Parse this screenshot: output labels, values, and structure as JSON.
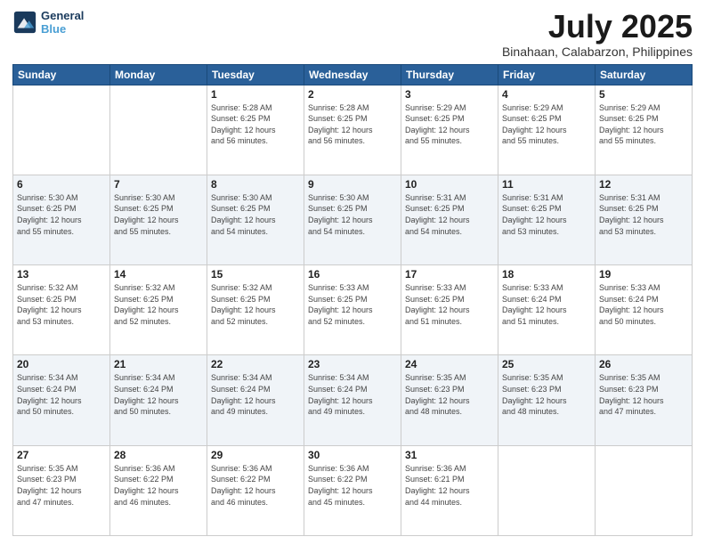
{
  "logo": {
    "line1": "General",
    "line2": "Blue"
  },
  "title": "July 2025",
  "subtitle": "Binahaan, Calabarzon, Philippines",
  "days_of_week": [
    "Sunday",
    "Monday",
    "Tuesday",
    "Wednesday",
    "Thursday",
    "Friday",
    "Saturday"
  ],
  "weeks": [
    [
      {
        "day": "",
        "info": ""
      },
      {
        "day": "",
        "info": ""
      },
      {
        "day": "1",
        "info": "Sunrise: 5:28 AM\nSunset: 6:25 PM\nDaylight: 12 hours\nand 56 minutes."
      },
      {
        "day": "2",
        "info": "Sunrise: 5:28 AM\nSunset: 6:25 PM\nDaylight: 12 hours\nand 56 minutes."
      },
      {
        "day": "3",
        "info": "Sunrise: 5:29 AM\nSunset: 6:25 PM\nDaylight: 12 hours\nand 55 minutes."
      },
      {
        "day": "4",
        "info": "Sunrise: 5:29 AM\nSunset: 6:25 PM\nDaylight: 12 hours\nand 55 minutes."
      },
      {
        "day": "5",
        "info": "Sunrise: 5:29 AM\nSunset: 6:25 PM\nDaylight: 12 hours\nand 55 minutes."
      }
    ],
    [
      {
        "day": "6",
        "info": "Sunrise: 5:30 AM\nSunset: 6:25 PM\nDaylight: 12 hours\nand 55 minutes."
      },
      {
        "day": "7",
        "info": "Sunrise: 5:30 AM\nSunset: 6:25 PM\nDaylight: 12 hours\nand 55 minutes."
      },
      {
        "day": "8",
        "info": "Sunrise: 5:30 AM\nSunset: 6:25 PM\nDaylight: 12 hours\nand 54 minutes."
      },
      {
        "day": "9",
        "info": "Sunrise: 5:30 AM\nSunset: 6:25 PM\nDaylight: 12 hours\nand 54 minutes."
      },
      {
        "day": "10",
        "info": "Sunrise: 5:31 AM\nSunset: 6:25 PM\nDaylight: 12 hours\nand 54 minutes."
      },
      {
        "day": "11",
        "info": "Sunrise: 5:31 AM\nSunset: 6:25 PM\nDaylight: 12 hours\nand 53 minutes."
      },
      {
        "day": "12",
        "info": "Sunrise: 5:31 AM\nSunset: 6:25 PM\nDaylight: 12 hours\nand 53 minutes."
      }
    ],
    [
      {
        "day": "13",
        "info": "Sunrise: 5:32 AM\nSunset: 6:25 PM\nDaylight: 12 hours\nand 53 minutes."
      },
      {
        "day": "14",
        "info": "Sunrise: 5:32 AM\nSunset: 6:25 PM\nDaylight: 12 hours\nand 52 minutes."
      },
      {
        "day": "15",
        "info": "Sunrise: 5:32 AM\nSunset: 6:25 PM\nDaylight: 12 hours\nand 52 minutes."
      },
      {
        "day": "16",
        "info": "Sunrise: 5:33 AM\nSunset: 6:25 PM\nDaylight: 12 hours\nand 52 minutes."
      },
      {
        "day": "17",
        "info": "Sunrise: 5:33 AM\nSunset: 6:25 PM\nDaylight: 12 hours\nand 51 minutes."
      },
      {
        "day": "18",
        "info": "Sunrise: 5:33 AM\nSunset: 6:24 PM\nDaylight: 12 hours\nand 51 minutes."
      },
      {
        "day": "19",
        "info": "Sunrise: 5:33 AM\nSunset: 6:24 PM\nDaylight: 12 hours\nand 50 minutes."
      }
    ],
    [
      {
        "day": "20",
        "info": "Sunrise: 5:34 AM\nSunset: 6:24 PM\nDaylight: 12 hours\nand 50 minutes."
      },
      {
        "day": "21",
        "info": "Sunrise: 5:34 AM\nSunset: 6:24 PM\nDaylight: 12 hours\nand 50 minutes."
      },
      {
        "day": "22",
        "info": "Sunrise: 5:34 AM\nSunset: 6:24 PM\nDaylight: 12 hours\nand 49 minutes."
      },
      {
        "day": "23",
        "info": "Sunrise: 5:34 AM\nSunset: 6:24 PM\nDaylight: 12 hours\nand 49 minutes."
      },
      {
        "day": "24",
        "info": "Sunrise: 5:35 AM\nSunset: 6:23 PM\nDaylight: 12 hours\nand 48 minutes."
      },
      {
        "day": "25",
        "info": "Sunrise: 5:35 AM\nSunset: 6:23 PM\nDaylight: 12 hours\nand 48 minutes."
      },
      {
        "day": "26",
        "info": "Sunrise: 5:35 AM\nSunset: 6:23 PM\nDaylight: 12 hours\nand 47 minutes."
      }
    ],
    [
      {
        "day": "27",
        "info": "Sunrise: 5:35 AM\nSunset: 6:23 PM\nDaylight: 12 hours\nand 47 minutes."
      },
      {
        "day": "28",
        "info": "Sunrise: 5:36 AM\nSunset: 6:22 PM\nDaylight: 12 hours\nand 46 minutes."
      },
      {
        "day": "29",
        "info": "Sunrise: 5:36 AM\nSunset: 6:22 PM\nDaylight: 12 hours\nand 46 minutes."
      },
      {
        "day": "30",
        "info": "Sunrise: 5:36 AM\nSunset: 6:22 PM\nDaylight: 12 hours\nand 45 minutes."
      },
      {
        "day": "31",
        "info": "Sunrise: 5:36 AM\nSunset: 6:21 PM\nDaylight: 12 hours\nand 44 minutes."
      },
      {
        "day": "",
        "info": ""
      },
      {
        "day": "",
        "info": ""
      }
    ]
  ]
}
